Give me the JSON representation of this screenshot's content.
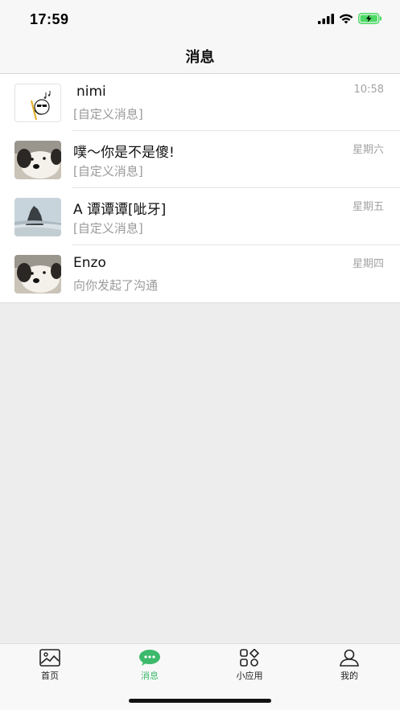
{
  "status_bar": {
    "time": "17:59"
  },
  "header": {
    "title": "消息"
  },
  "conversations": [
    {
      "name": "nimi",
      "message": "[自定义消息]",
      "time": "10:58"
    },
    {
      "name": "噗～你是不是傻!",
      "message": "[自定义消息]",
      "time": "星期六"
    },
    {
      "name": "A 谭谭谭[呲牙]",
      "message": "[自定义消息]",
      "time": "星期五"
    },
    {
      "name": "Enzo",
      "message": "向你发起了沟通",
      "time": "星期四"
    }
  ],
  "tabbar": {
    "items": [
      {
        "label": "首页",
        "icon": "image-icon"
      },
      {
        "label": "消息",
        "icon": "chat-bubble-icon"
      },
      {
        "label": "小应用",
        "icon": "apps-icon"
      },
      {
        "label": "我的",
        "icon": "user-icon"
      }
    ],
    "active_color": "#3cb96b"
  }
}
